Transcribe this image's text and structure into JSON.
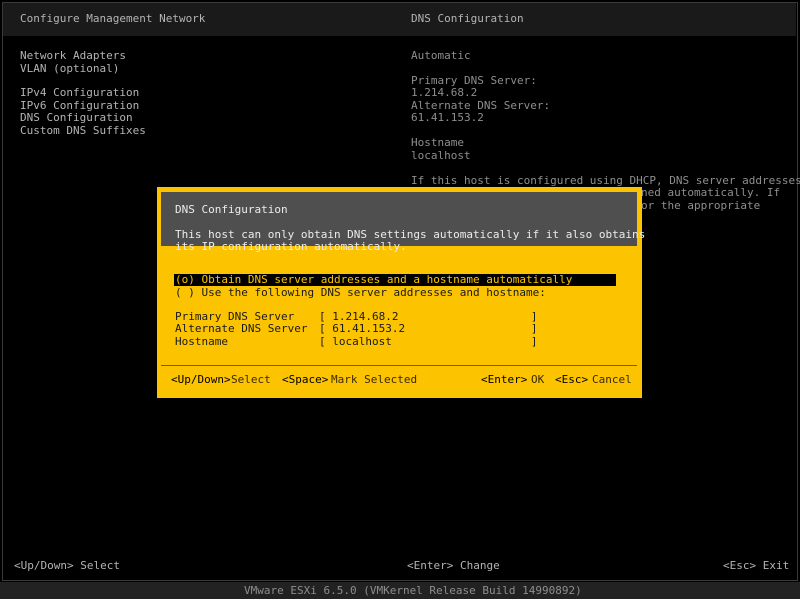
{
  "header": {
    "left_title": "Configure Management Network",
    "right_title": "DNS Configuration"
  },
  "menu": [
    "Network Adapters",
    "VLAN (optional)",
    "IPv4 Configuration",
    "IPv6 Configuration",
    "DNS Configuration",
    "Custom DNS Suffixes"
  ],
  "info": {
    "mode": "Automatic",
    "primary_label": "Primary DNS Server:",
    "primary_value": "1.214.68.2",
    "alternate_label": "Alternate DNS Server:",
    "alternate_value": "61.41.153.2",
    "hostname_label": "Hostname",
    "hostname_value": "localhost",
    "note_line1": "If this host is configured using DHCP, DNS server addresses",
    "note_line2": "ned automatically. If",
    "note_line3": "or the appropriate"
  },
  "dialog": {
    "title": "DNS Configuration",
    "desc_line1": "This host can only obtain DNS settings automatically if it also obtains",
    "desc_line2": "its IP configuration automatically.",
    "option_auto": "(o) Obtain DNS server addresses and a hostname automatically",
    "option_manual": "( ) Use the following DNS server addresses and hostname:",
    "primary_label": "Primary DNS Server",
    "primary_value": "[ 1.214.68.2                    ]",
    "alternate_label": "Alternate DNS Server",
    "alternate_value": "[ 61.41.153.2                   ]",
    "hostname_label": "Hostname",
    "hostname_value": "[ localhost                     ]",
    "key_select": "<Up/Down>",
    "key_select_label": "Select",
    "key_mark": "<Space>",
    "key_mark_label": "Mark Selected",
    "key_ok": "<Enter>",
    "key_ok_label": "OK",
    "key_cancel": "<Esc>",
    "key_cancel_label": "Cancel"
  },
  "footer": {
    "select": "<Up/Down> Select",
    "change": "<Enter> Change",
    "exit": "<Esc> Exit"
  },
  "status": "VMware ESXi 6.5.0 (VMKernel Release Build 14990892)",
  "colors": {
    "dialog_yellow": "#fcc300",
    "dialog_header": "#4f4f4f",
    "background": "#000000"
  }
}
